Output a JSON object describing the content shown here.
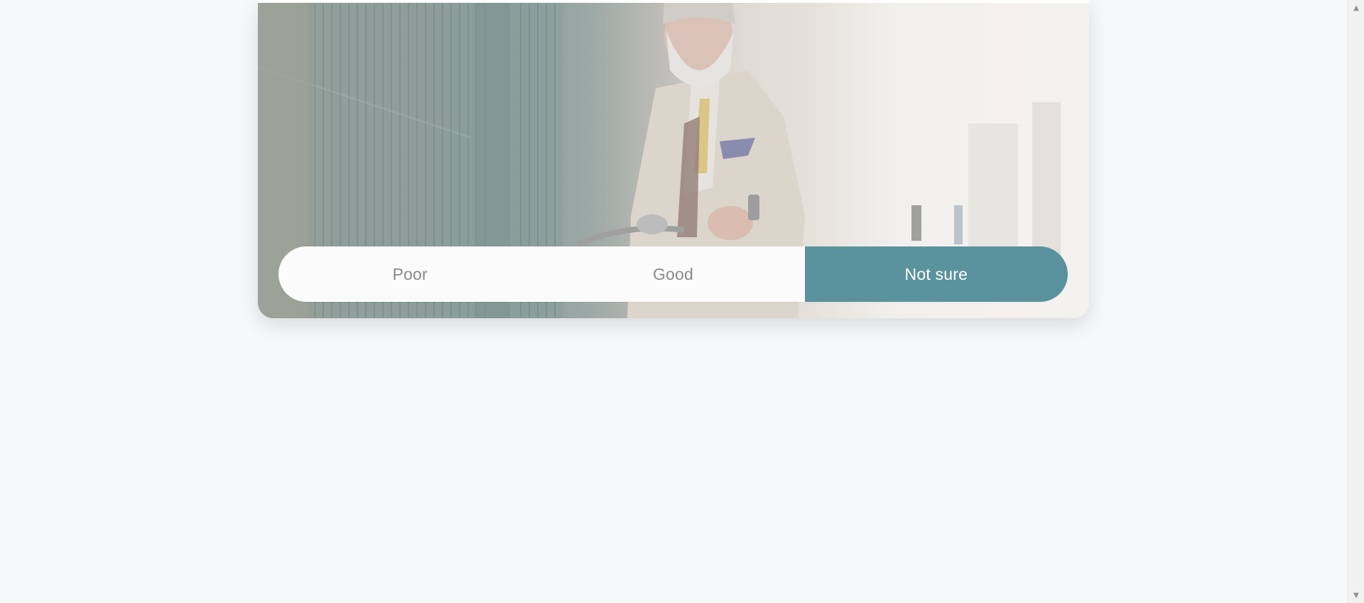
{
  "photo": {
    "icon": "photo-image",
    "subject": "bearded-man-with-bicycle"
  },
  "rating": {
    "options": [
      {
        "label": "Poor",
        "selected": false
      },
      {
        "label": "Good",
        "selected": false
      },
      {
        "label": "Not sure",
        "selected": true
      }
    ],
    "accent_color": "#5a929d"
  },
  "scrollbar": {
    "up_icon": "triangle-up-icon",
    "down_icon": "triangle-down-icon"
  }
}
